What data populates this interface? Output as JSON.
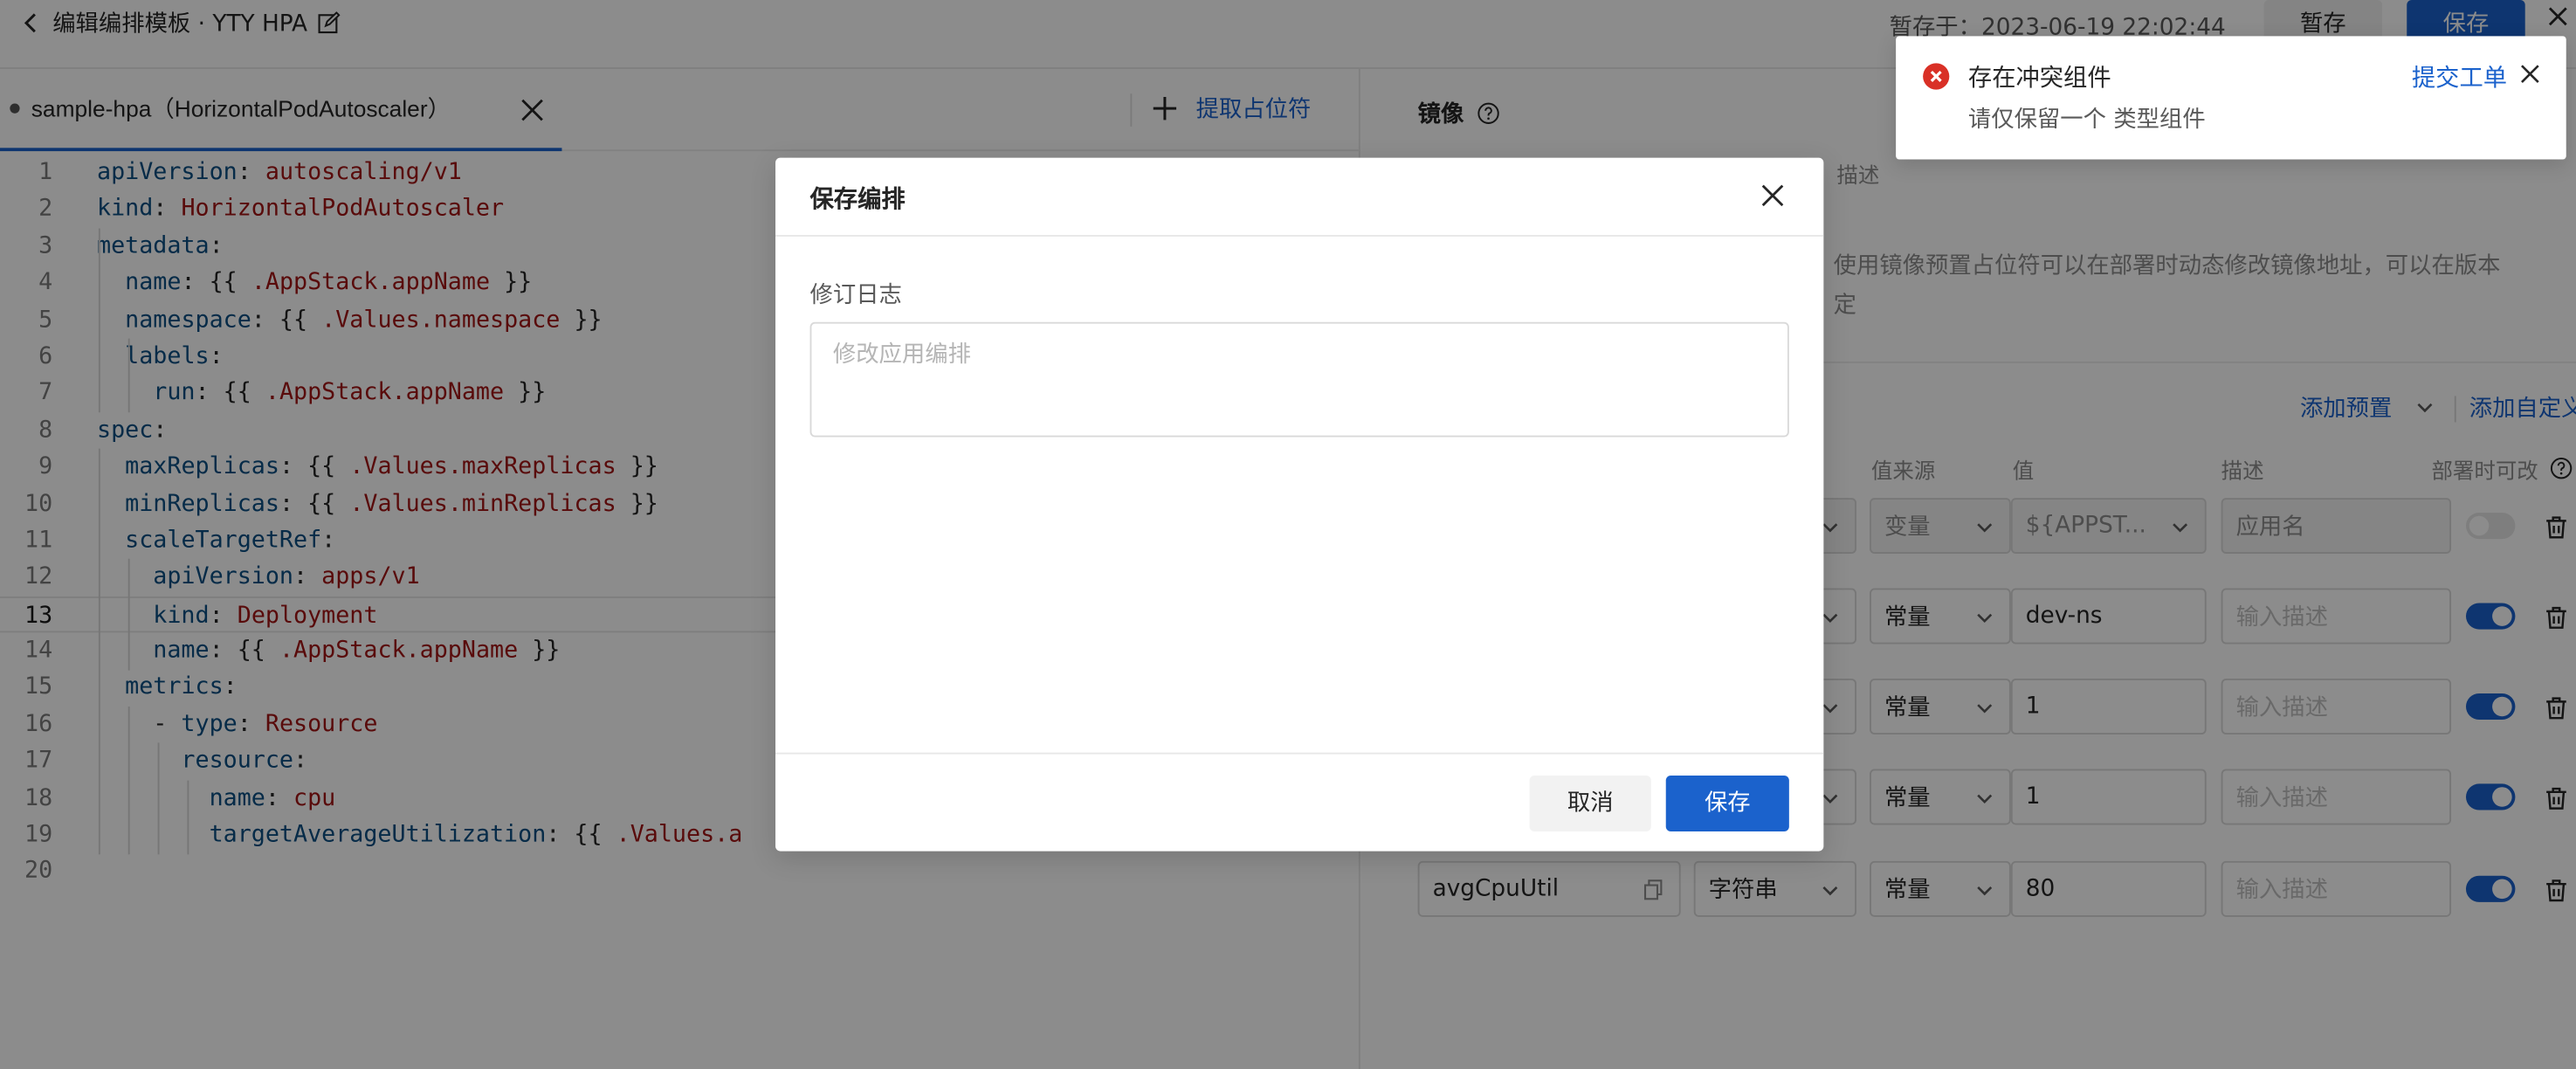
{
  "header": {
    "title": "编辑编排模板 · YTY HPA",
    "saved_at": "暂存于：2023-06-19 22:02:44",
    "draft_label": "暂存",
    "save_label": "保存"
  },
  "editor": {
    "tab_label": "sample-hpa（HorizontalPodAutoscaler）",
    "extract_label": "提取占位符",
    "current_line": 13,
    "lines": [
      [
        [
          "k",
          "apiVersion"
        ],
        [
          "p",
          ": "
        ],
        [
          "v",
          "autoscaling/v1"
        ]
      ],
      [
        [
          "k",
          "kind"
        ],
        [
          "p",
          ": "
        ],
        [
          "v",
          "HorizontalPodAutoscaler"
        ]
      ],
      [
        [
          "k",
          "metadata"
        ],
        [
          "p",
          ":"
        ]
      ],
      [
        [
          "p",
          "  "
        ],
        [
          "k",
          "name"
        ],
        [
          "p",
          ": {{ "
        ],
        [
          "v",
          ".AppStack.appName"
        ],
        [
          "p",
          " }}"
        ]
      ],
      [
        [
          "p",
          "  "
        ],
        [
          "k",
          "namespace"
        ],
        [
          "p",
          ": {{ "
        ],
        [
          "v",
          ".Values.namespace"
        ],
        [
          "p",
          " }}"
        ]
      ],
      [
        [
          "p",
          "  "
        ],
        [
          "k",
          "labels"
        ],
        [
          "p",
          ":"
        ]
      ],
      [
        [
          "p",
          "    "
        ],
        [
          "k",
          "run"
        ],
        [
          "p",
          ": {{ "
        ],
        [
          "v",
          ".AppStack.appName"
        ],
        [
          "p",
          " }}"
        ]
      ],
      [
        [
          "k",
          "spec"
        ],
        [
          "p",
          ":"
        ]
      ],
      [
        [
          "p",
          "  "
        ],
        [
          "k",
          "maxReplicas"
        ],
        [
          "p",
          ": {{ "
        ],
        [
          "v",
          ".Values.maxReplicas"
        ],
        [
          "p",
          " }}"
        ]
      ],
      [
        [
          "p",
          "  "
        ],
        [
          "k",
          "minReplicas"
        ],
        [
          "p",
          ": {{ "
        ],
        [
          "v",
          ".Values.minReplicas"
        ],
        [
          "p",
          " }}"
        ]
      ],
      [
        [
          "p",
          "  "
        ],
        [
          "k",
          "scaleTargetRef"
        ],
        [
          "p",
          ":"
        ]
      ],
      [
        [
          "p",
          "    "
        ],
        [
          "k",
          "apiVersion"
        ],
        [
          "p",
          ": "
        ],
        [
          "v",
          "apps/v1"
        ]
      ],
      [
        [
          "p",
          "    "
        ],
        [
          "k",
          "kind"
        ],
        [
          "p",
          ": "
        ],
        [
          "v",
          "Deployment"
        ]
      ],
      [
        [
          "p",
          "    "
        ],
        [
          "k",
          "name"
        ],
        [
          "p",
          ": {{ "
        ],
        [
          "v",
          ".AppStack.appName"
        ],
        [
          "p",
          " }}"
        ]
      ],
      [
        [
          "p",
          "  "
        ],
        [
          "k",
          "metrics"
        ],
        [
          "p",
          ":"
        ]
      ],
      [
        [
          "p",
          "    - "
        ],
        [
          "k",
          "type"
        ],
        [
          "p",
          ": "
        ],
        [
          "v",
          "Resource"
        ]
      ],
      [
        [
          "p",
          "      "
        ],
        [
          "k",
          "resource"
        ],
        [
          "p",
          ":"
        ]
      ],
      [
        [
          "p",
          "        "
        ],
        [
          "k",
          "name"
        ],
        [
          "p",
          ": "
        ],
        [
          "v",
          "cpu"
        ]
      ],
      [
        [
          "p",
          "        "
        ],
        [
          "k",
          "targetAverageUtilization"
        ],
        [
          "p",
          ": {{ "
        ],
        [
          "v",
          ".Values.a"
        ]
      ],
      []
    ]
  },
  "right_panel": {
    "section_title": "镜像",
    "desc_head": "描述",
    "tip": "使用镜像预置占位符可以在部署时动态修改镜像地址，可以在版本",
    "tip_line2": "定",
    "add_preset": "添加预置",
    "add_custom": "添加自定义",
    "columns": {
      "source": "值来源",
      "value": "值",
      "desc": "描述",
      "deploy_editable": "部署时可改"
    },
    "rows": [
      {
        "source": "变量",
        "value": "${APPST...",
        "desc": "应用名",
        "editable": false,
        "disabled": true
      },
      {
        "source": "常量",
        "value": "dev-ns",
        "desc": "输入描述",
        "editable": true,
        "disabled": false
      },
      {
        "source": "常量",
        "value": "1",
        "desc": "输入描述",
        "editable": true,
        "disabled": false
      },
      {
        "source": "常量",
        "value": "1",
        "desc": "输入描述",
        "editable": true,
        "disabled": false
      },
      {
        "name": "avgCpuUtil",
        "type": "字符串",
        "source": "常量",
        "value": "80",
        "desc": "输入描述",
        "editable": true,
        "disabled": false
      }
    ]
  },
  "modal": {
    "title": "保存编排",
    "field_label": "修订日志",
    "field_placeholder": "修改应用编排",
    "cancel_label": "取消",
    "save_label": "保存"
  },
  "notice": {
    "title": "存在冲突组件",
    "desc": "请仅保留一个 类型组件",
    "link": "提交工单"
  },
  "colors": {
    "primary": "#1b62cc",
    "error": "#d93026",
    "yaml_key": "#0b4f83",
    "yaml_value": "#a31515"
  }
}
